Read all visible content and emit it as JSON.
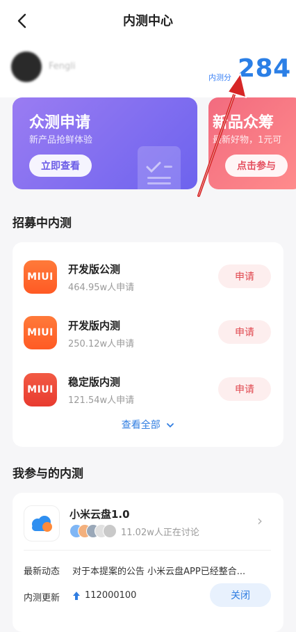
{
  "header": {
    "title": "内测中心"
  },
  "profile": {
    "username": "Fengli",
    "score_label": "内测分",
    "score_value": "284"
  },
  "cards": [
    {
      "title": "众测申请",
      "subtitle": "新产品抢鲜体验",
      "button": "立即查看"
    },
    {
      "title": "新品众筹",
      "subtitle": "最新好物，1元可",
      "button": "点击参与"
    }
  ],
  "recruiting": {
    "title": "招募中内测",
    "items": [
      {
        "icon_text": "MIUI",
        "name": "开发版公测",
        "count": "464.95w人申请",
        "button": "申请"
      },
      {
        "icon_text": "MIUI",
        "name": "开发版内测",
        "count": "250.12w人申请",
        "button": "申请"
      },
      {
        "icon_text": "MIUI",
        "name": "稳定版内测",
        "count": "121.54w人申请",
        "button": "申请"
      }
    ],
    "view_all": "查看全部"
  },
  "participated": {
    "title": "我参与的内测",
    "app_name": "小米云盘1.0",
    "discussing": "11.02w人正在讨论",
    "latest_label": "最新动态",
    "latest_text": "对于本提案的公告 小米云盘APP已经整合...",
    "update_label": "内测更新",
    "update_value": "112000100",
    "action_button": "关闭"
  },
  "colors": {
    "accent_blue": "#2b7fe6",
    "miui_orange": "#ff6a2b",
    "miui_red": "#f04a3a",
    "purple_card": "#7b6cf0",
    "pink_card": "#f26b7f"
  }
}
